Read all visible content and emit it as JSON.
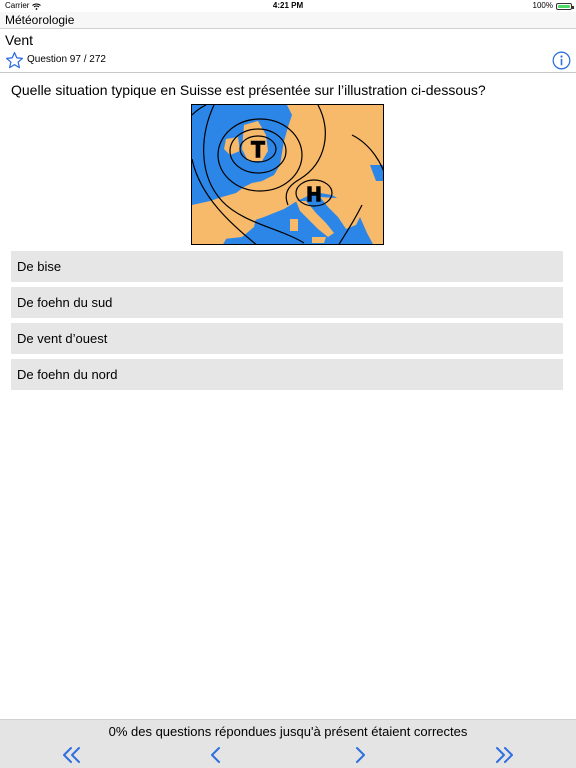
{
  "status_bar": {
    "carrier": "Carrier",
    "time": "4:21 PM",
    "battery": "100%",
    "battery_level": 1.0
  },
  "nav_bar": {
    "title": "Météorologie"
  },
  "section": {
    "title": "Vent"
  },
  "question": {
    "counter": "Question 97 / 272",
    "text": "Quelle situation typique en Suisse est présentée sur l’illustration ci-dessous?"
  },
  "map": {
    "low_label": "T",
    "high_label": "H"
  },
  "answers": [
    {
      "label": "De bise"
    },
    {
      "label": "De foehn du sud"
    },
    {
      "label": "De vent d’ouest"
    },
    {
      "label": "De foehn du nord"
    }
  ],
  "footer": {
    "score_text": "0% des questions répondues jusqu'à présent étaient correctes"
  },
  "colors": {
    "accent": "#2f6fe0",
    "sea": "#2b86e8",
    "land": "#f7b96a",
    "answer_bg": "#e6e6e6",
    "footer_bg": "#e4e4e4"
  },
  "icons": [
    "wifi-icon",
    "battery-icon",
    "star-icon",
    "info-icon",
    "first-icon",
    "previous-icon",
    "next-icon",
    "last-icon"
  ]
}
